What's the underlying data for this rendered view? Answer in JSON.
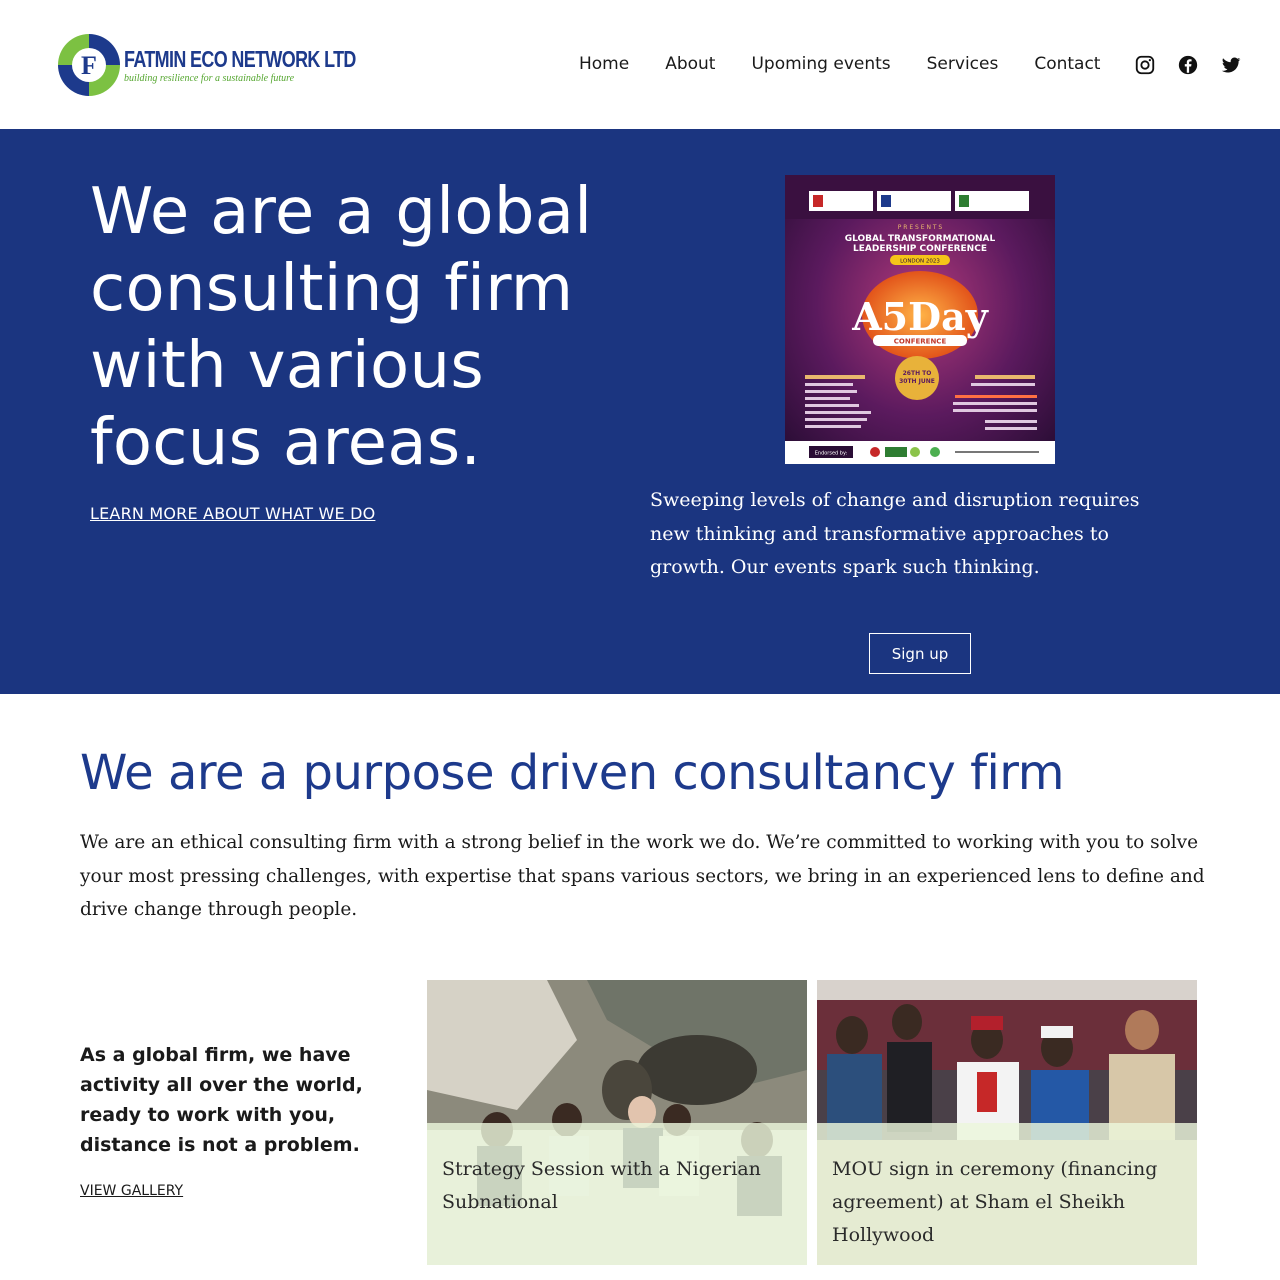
{
  "header": {
    "logo": {
      "name": "FATMIN ECO NETWORK LTD",
      "tagline": "building resilience for a sustainable future",
      "mark_letter": "F"
    },
    "nav": [
      {
        "label": "Home"
      },
      {
        "label": "About"
      },
      {
        "label": "Upoming events"
      },
      {
        "label": "Services"
      },
      {
        "label": "Contact"
      }
    ],
    "social": [
      {
        "icon": "instagram-icon"
      },
      {
        "icon": "facebook-icon"
      },
      {
        "icon": "twitter-icon"
      }
    ]
  },
  "hero": {
    "title": "We are a global consulting firm with various focus areas.",
    "link": "LEARN MORE ABOUT WHAT WE DO",
    "description": "Sweeping levels of change and disruption requires new thinking and transformative approaches to growth. Our events spark such thinking.",
    "button": "Sign up",
    "poster": {
      "presents": "P R E S E N T S",
      "title": "GLOBAL TRANSFORMATIONAL LEADERSHIP CONFERENCE",
      "location": "LONDON 2023",
      "big": "A5Day",
      "sub": "CONFERENCE",
      "dates": "26TH TO 30TH JUNE 2023",
      "endorsed": "Endorsed by:"
    }
  },
  "purpose": {
    "title": "We are a purpose driven consultancy firm",
    "text": "We are an ethical consulting firm with a strong belief in the work we do. We’re committed to working with you to solve your most pressing challenges, with expertise that spans various sectors, we bring in an experienced lens to define and drive change through people."
  },
  "global": {
    "text": "As a global firm, we have activity all over the world, ready to work with you, distance is not a problem.",
    "link": "VIEW GALLERY"
  },
  "gallery": [
    {
      "caption": "Strategy Session with a Nigerian Subnational"
    },
    {
      "caption": "MOU sign in ceremony (financing agreement) at Sham el Sheikh Hollywood"
    }
  ],
  "colors": {
    "brand_blue": "#1b3580",
    "title_blue": "#1d3a8c",
    "logo_green": "#55a630"
  }
}
